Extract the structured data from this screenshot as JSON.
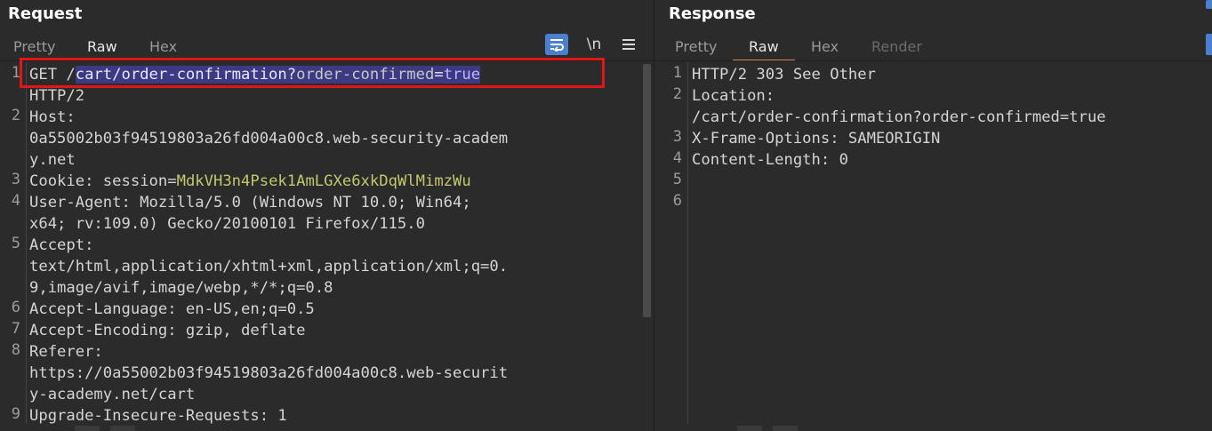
{
  "request": {
    "title": "Request",
    "tabs": [
      "Pretty",
      "Raw",
      "Hex"
    ],
    "active_tab": "Raw",
    "toolbar": {
      "wrap_icon": "text-wrap-icon",
      "newline_label": "\\n",
      "menu_icon": "hamburger-menu-icon"
    },
    "lines": [
      {
        "n": "1",
        "rows": [
          [
            {
              "t": "GET /"
            },
            {
              "t": "cart/order-confirmation?",
              "sel": true
            },
            {
              "t": "order-confirmed",
              "c": "qn",
              "sel": true
            },
            {
              "t": "=",
              "sel": true
            },
            {
              "t": "true",
              "c": "qv",
              "sel": true
            }
          ],
          [
            {
              "t": "HTTP/2"
            }
          ]
        ]
      },
      {
        "n": "2",
        "rows": [
          [
            {
              "t": "Host: "
            }
          ],
          [
            {
              "t": "0a55002b03f94519803a26fd004a00c8.web-security-academ"
            }
          ],
          [
            {
              "t": "y.net"
            }
          ]
        ]
      },
      {
        "n": "3",
        "rows": [
          [
            {
              "t": "Cookie: "
            },
            {
              "t": "session",
              "c": "ck"
            },
            {
              "t": "="
            },
            {
              "t": "MdkVH3n4Psek1AmLGXe6xkDqWlMimzWu",
              "c": "cv"
            }
          ]
        ]
      },
      {
        "n": "4",
        "rows": [
          [
            {
              "t": "User-Agent: Mozilla/5.0 (Windows NT 10.0; Win64;"
            }
          ],
          [
            {
              "t": "x64; rv:109.0) Gecko/20100101 Firefox/115.0"
            }
          ]
        ]
      },
      {
        "n": "5",
        "rows": [
          [
            {
              "t": "Accept: "
            }
          ],
          [
            {
              "t": "text/html,application/xhtml+xml,application/xml;q=0."
            }
          ],
          [
            {
              "t": "9,image/avif,image/webp,*/*;q=0.8"
            }
          ]
        ]
      },
      {
        "n": "6",
        "rows": [
          [
            {
              "t": "Accept-Language: en-US,en;q=0.5"
            }
          ]
        ]
      },
      {
        "n": "7",
        "rows": [
          [
            {
              "t": "Accept-Encoding: gzip, deflate"
            }
          ]
        ]
      },
      {
        "n": "8",
        "rows": [
          [
            {
              "t": "Referer: "
            }
          ],
          [
            {
              "t": "https://0a55002b03f94519803a26fd004a00c8.web-securit"
            }
          ],
          [
            {
              "t": "y-academy.net/cart"
            }
          ]
        ]
      },
      {
        "n": "9",
        "rows": [
          [
            {
              "t": "Upgrade-Insecure-Requests: 1"
            }
          ]
        ]
      }
    ]
  },
  "response": {
    "title": "Response",
    "tabs": [
      "Pretty",
      "Raw",
      "Hex",
      "Render"
    ],
    "active_tab": "Raw",
    "lines": [
      {
        "n": "1",
        "rows": [
          [
            {
              "t": "HTTP/2 303 See Other"
            }
          ]
        ]
      },
      {
        "n": "2",
        "rows": [
          [
            {
              "t": "Location: "
            }
          ],
          [
            {
              "t": "/cart/order-confirmation?order-confirmed=true"
            }
          ]
        ]
      },
      {
        "n": "3",
        "rows": [
          [
            {
              "t": "X-Frame-Options: SAMEORIGIN"
            }
          ]
        ]
      },
      {
        "n": "4",
        "rows": [
          [
            {
              "t": "Content-Length: 0"
            }
          ]
        ]
      },
      {
        "n": "5",
        "rows": [
          [
            {
              "t": ""
            }
          ]
        ]
      },
      {
        "n": "6",
        "rows": [
          [
            {
              "t": ""
            }
          ]
        ]
      }
    ]
  },
  "colors": {
    "accent_blue": "#4b7fd0",
    "highlight_red": "#e11616",
    "active_tab_underline": "#e0884a"
  }
}
